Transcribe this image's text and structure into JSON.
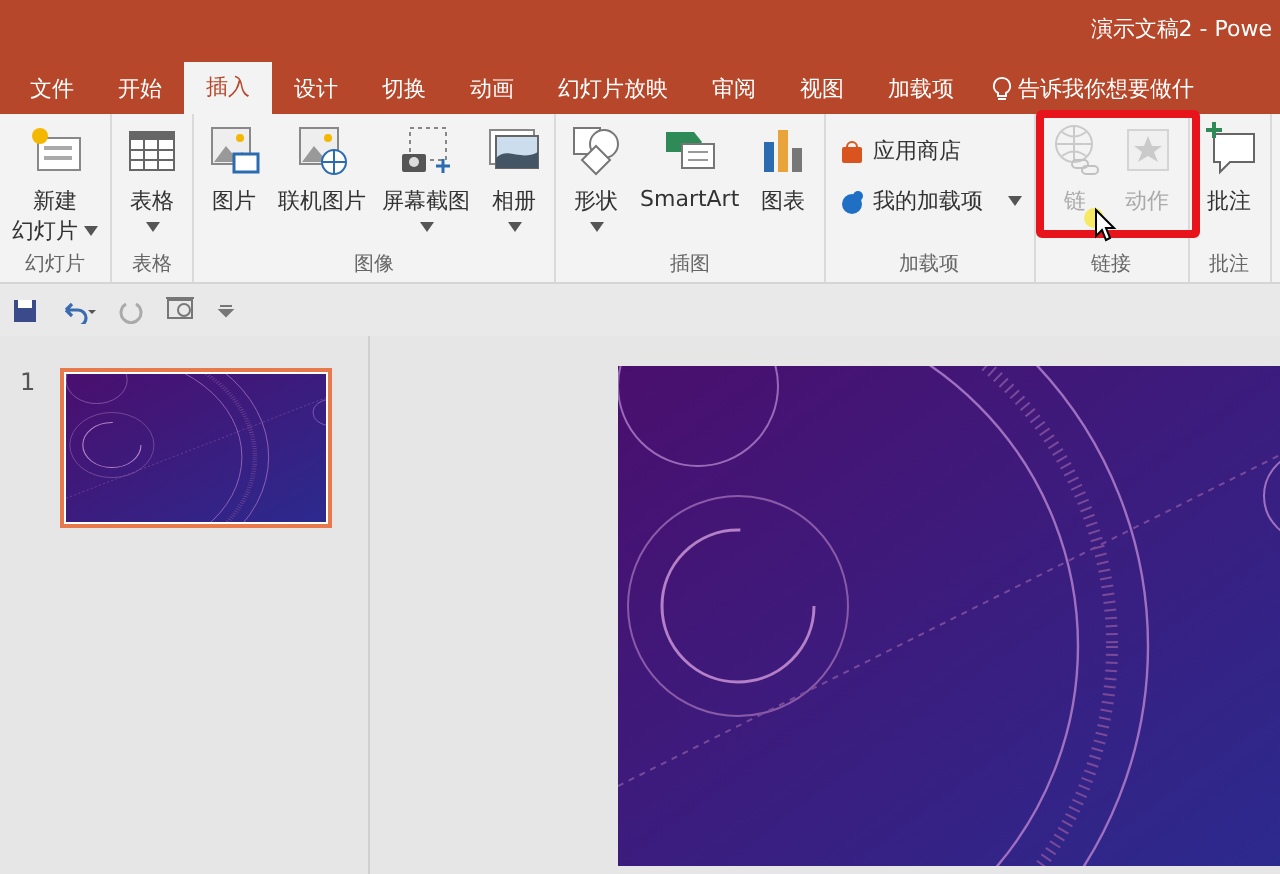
{
  "window": {
    "title": "演示文稿2  -  Powe"
  },
  "tabs": [
    {
      "label": "文件",
      "selected": false
    },
    {
      "label": "开始",
      "selected": false
    },
    {
      "label": "插入",
      "selected": true
    },
    {
      "label": "设计",
      "selected": false
    },
    {
      "label": "切换",
      "selected": false
    },
    {
      "label": "动画",
      "selected": false
    },
    {
      "label": "幻灯片放映",
      "selected": false
    },
    {
      "label": "审阅",
      "selected": false
    },
    {
      "label": "视图",
      "selected": false
    },
    {
      "label": "加载项",
      "selected": false
    }
  ],
  "tell_me": {
    "placeholder": "告诉我你想要做什"
  },
  "ribbon": {
    "groups": [
      {
        "label": "幻灯片",
        "items": [
          {
            "kind": "large",
            "label": "新建",
            "label2": "幻灯片",
            "dropdown": true,
            "disabled": false
          }
        ]
      },
      {
        "label": "表格",
        "items": [
          {
            "kind": "large",
            "label": "表格",
            "dropdown": true,
            "disabled": false
          }
        ]
      },
      {
        "label": "图像",
        "items": [
          {
            "kind": "large",
            "label": "图片",
            "dropdown": false,
            "disabled": false
          },
          {
            "kind": "large",
            "label": "联机图片",
            "dropdown": false,
            "disabled": false
          },
          {
            "kind": "large",
            "label": "屏幕截图",
            "dropdown": true,
            "disabled": false
          },
          {
            "kind": "large",
            "label": "相册",
            "dropdown": true,
            "disabled": false
          }
        ]
      },
      {
        "label": "插图",
        "items": [
          {
            "kind": "large",
            "label": "形状",
            "dropdown": true,
            "disabled": false
          },
          {
            "kind": "large",
            "label": "SmartArt",
            "dropdown": false,
            "disabled": false
          },
          {
            "kind": "large",
            "label": "图表",
            "dropdown": false,
            "disabled": false
          }
        ]
      },
      {
        "label": "加载项",
        "items": [
          {
            "kind": "small",
            "label": "应用商店",
            "dropdown": false,
            "disabled": false
          },
          {
            "kind": "small",
            "label": "我的加载项",
            "dropdown": true,
            "disabled": false
          }
        ]
      },
      {
        "label": "链接",
        "highlighted": true,
        "items": [
          {
            "kind": "large",
            "label": "链",
            "dropdown": false,
            "disabled": true
          },
          {
            "kind": "large",
            "label": "动作",
            "dropdown": false,
            "disabled": true
          }
        ]
      },
      {
        "label": "批注",
        "items": [
          {
            "kind": "large",
            "label": "批注",
            "dropdown": false,
            "disabled": false
          }
        ]
      }
    ]
  },
  "slides": [
    {
      "number": "1",
      "selected": true
    }
  ]
}
